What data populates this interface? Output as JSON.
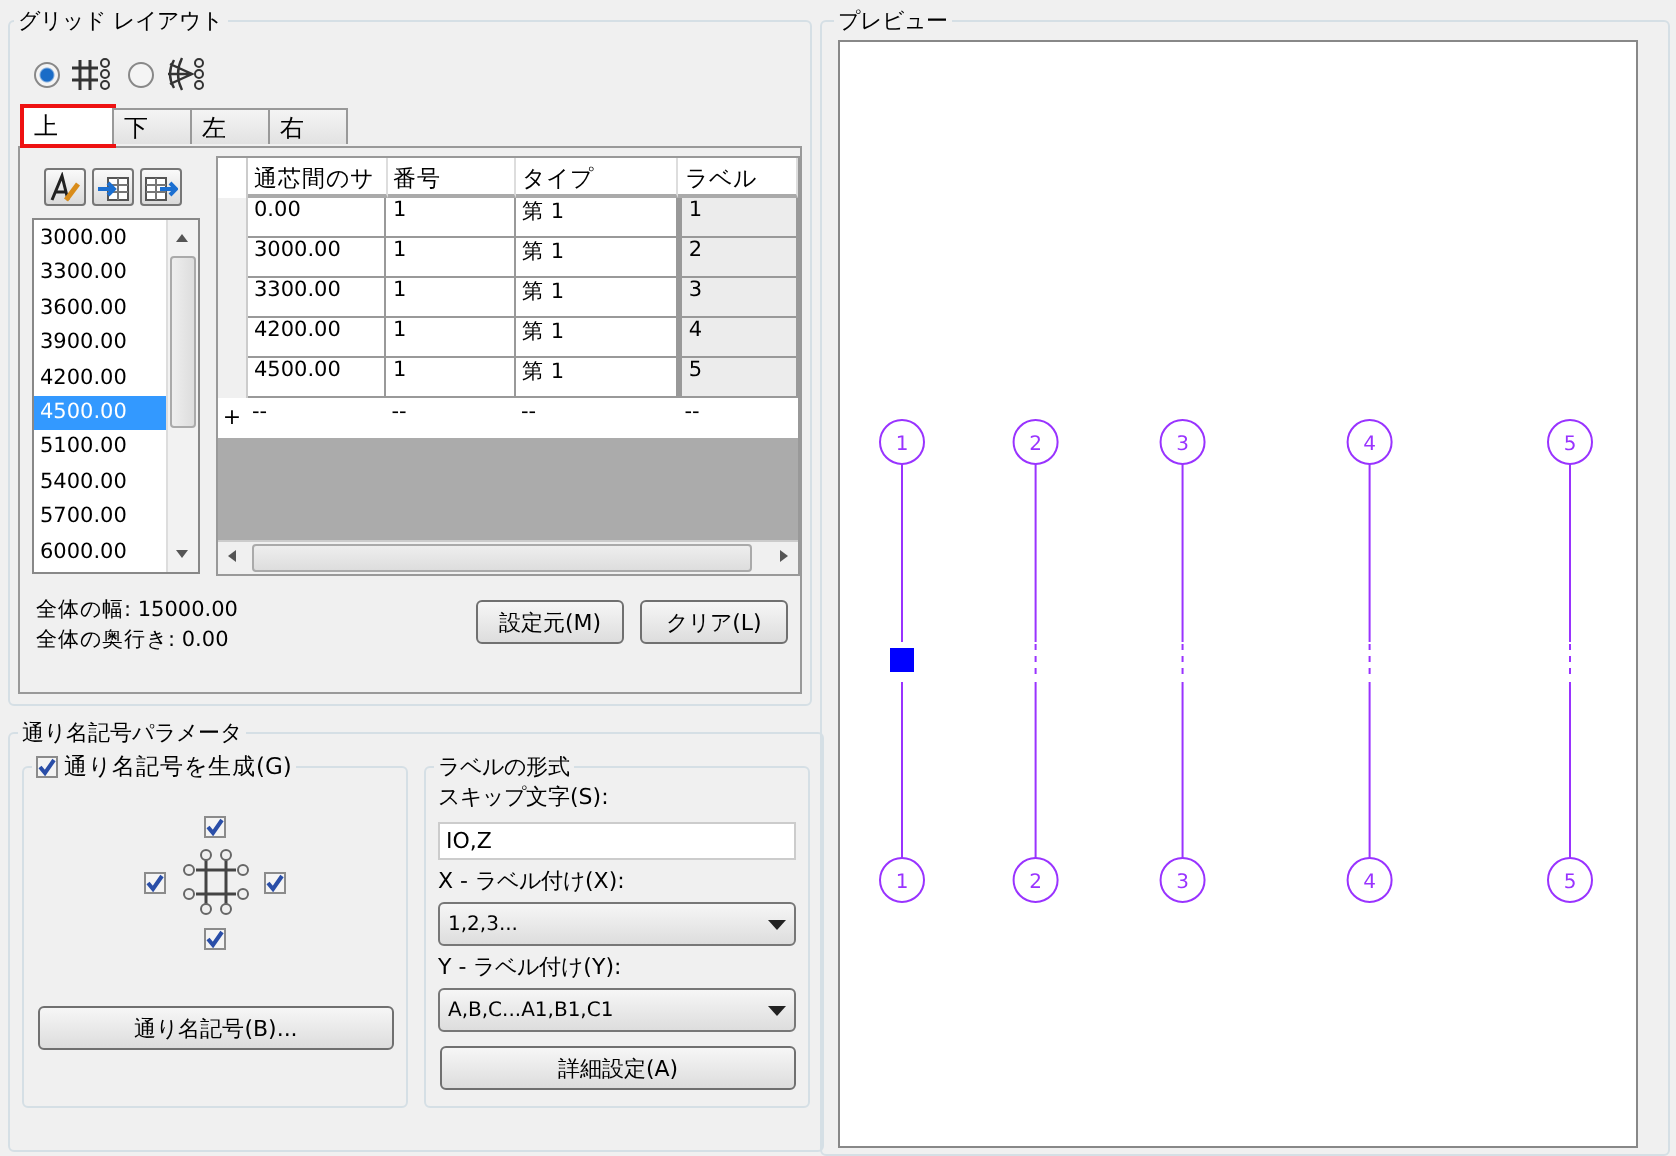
{
  "grid_layout": {
    "title": "グリッド レイアウト",
    "modes": [
      {
        "kind": "rect",
        "selected": true
      },
      {
        "kind": "radial",
        "selected": false
      }
    ],
    "tabs": [
      {
        "label": "上",
        "selected": true,
        "highlighted": true
      },
      {
        "label": "下",
        "selected": false,
        "highlighted": false
      },
      {
        "label": "左",
        "selected": false,
        "highlighted": false
      },
      {
        "label": "右",
        "selected": false,
        "highlighted": false
      }
    ],
    "spacing_list": [
      {
        "label": "3000.00",
        "selected": false
      },
      {
        "label": "3300.00",
        "selected": false
      },
      {
        "label": "3600.00",
        "selected": false
      },
      {
        "label": "3900.00",
        "selected": false
      },
      {
        "label": "4200.00",
        "selected": false
      },
      {
        "label": "4500.00",
        "selected": true
      },
      {
        "label": "5100.00",
        "selected": false
      },
      {
        "label": "5400.00",
        "selected": false
      },
      {
        "label": "5700.00",
        "selected": false
      },
      {
        "label": "6000.00",
        "selected": false
      }
    ],
    "table": {
      "columns": [
        "通芯間のサ",
        "番号",
        "タイプ",
        "ラベル"
      ],
      "rows": [
        [
          "0.00",
          "1",
          "第 1",
          "1"
        ],
        [
          "3000.00",
          "1",
          "第 1",
          "2"
        ],
        [
          "3300.00",
          "1",
          "第 1",
          "3"
        ],
        [
          "4200.00",
          "1",
          "第 1",
          "4"
        ],
        [
          "4500.00",
          "1",
          "第 1",
          "5"
        ]
      ],
      "new_row": {
        "marker": "+",
        "cells": [
          "--",
          "--",
          "--",
          "--"
        ]
      }
    },
    "total_width": "全体の幅: 15000.00",
    "total_depth": "全体の奥行き: 0.00",
    "buttons": [
      "設定元(M)",
      "クリア(L)"
    ]
  },
  "bubble_params": {
    "title": "通り名記号パラメータ",
    "generate": {
      "label": "通り名記号を生成(G)",
      "checked": true
    },
    "sides": [
      {
        "kind": "top",
        "checked": true
      },
      {
        "kind": "left",
        "checked": true
      },
      {
        "kind": "right",
        "checked": true
      },
      {
        "kind": "bottom",
        "checked": true
      }
    ],
    "bubble_button": "通り名記号(B)...",
    "label_format": {
      "title": "ラベルの形式",
      "skip_label": "スキップ文字(S):",
      "skip_value": "IO,Z",
      "x_label": "X - ラベル付け(X):",
      "x_value": "1,2,3...",
      "y_label": "Y - ラベル付け(Y):",
      "y_value": "A,B,C...A1,B1,C1",
      "advanced_button": "詳細設定(A)"
    }
  },
  "preview": {
    "title": "プレビュー",
    "axes": [
      {
        "top_label": "1",
        "bottom_label": "1",
        "selected": true
      },
      {
        "top_label": "2",
        "bottom_label": "2",
        "selected": false
      },
      {
        "top_label": "3",
        "bottom_label": "3",
        "selected": false
      },
      {
        "top_label": "4",
        "bottom_label": "4",
        "selected": false
      },
      {
        "top_label": "5",
        "bottom_label": "5",
        "selected": false
      }
    ]
  }
}
